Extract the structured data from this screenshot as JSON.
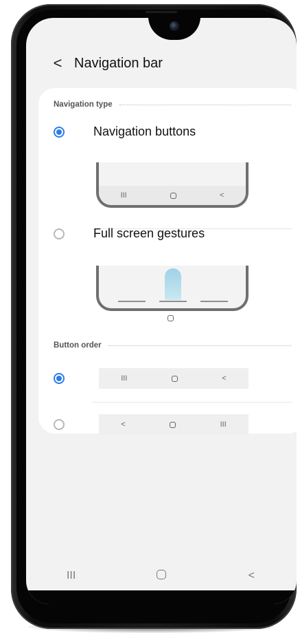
{
  "header": {
    "back_glyph": "<",
    "title": "Navigation bar"
  },
  "navigation_type": {
    "section_label": "Navigation type",
    "options": [
      {
        "label": "Navigation buttons",
        "selected": true
      },
      {
        "label": "Full screen gestures",
        "selected": false
      }
    ],
    "preview_buttons": {
      "recents": "III",
      "back": "<"
    }
  },
  "button_order": {
    "section_label": "Button order",
    "options": [
      {
        "selected": true,
        "left": "III",
        "right": "<"
      },
      {
        "selected": false,
        "left": "<",
        "right": "III"
      }
    ]
  },
  "system_nav": {
    "recents": "III",
    "back": "<"
  },
  "colors": {
    "accent": "#2b7de9",
    "swipe_indicator": "#9fd2e6"
  },
  "icons": [
    "back-arrow-icon",
    "recents-icon",
    "home-icon",
    "back-icon",
    "front-camera-icon"
  ]
}
